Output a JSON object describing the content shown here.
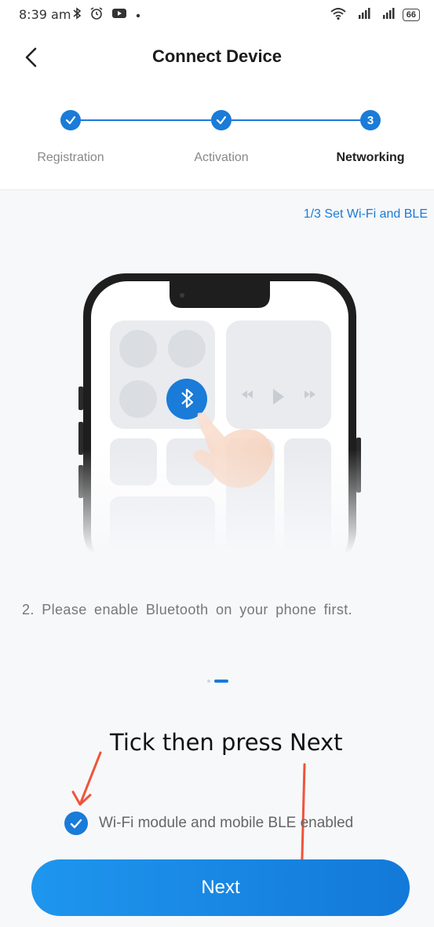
{
  "status_bar": {
    "time": "8:39 am",
    "battery": "66",
    "icons_left": [
      "bluetooth-icon",
      "alarm-icon",
      "media-icon",
      "dot-icon"
    ],
    "icons_right": [
      "wifi-icon",
      "signal-icon",
      "signal-icon"
    ]
  },
  "nav": {
    "title": "Connect Device",
    "back_icon": "chevron-left-icon"
  },
  "stepper": {
    "steps": [
      {
        "label": "Registration",
        "state": "done"
      },
      {
        "label": "Activation",
        "state": "done"
      },
      {
        "label": "Networking",
        "state": "current",
        "number": "3"
      }
    ]
  },
  "content": {
    "set_link": "1/3 Set Wi-Fi and BLE",
    "instruction": "2. Please enable Bluetooth on your phone first.",
    "pager": {
      "count": 2,
      "active": 1
    }
  },
  "annotation": {
    "text": "Tick then press Next",
    "color": "#f0533a"
  },
  "consent": {
    "label": "Wi-Fi module and mobile BLE enabled",
    "checked": true
  },
  "next_button": {
    "label": "Next"
  },
  "colors": {
    "accent": "#1a7bd8",
    "background": "#f7f8fa"
  }
}
